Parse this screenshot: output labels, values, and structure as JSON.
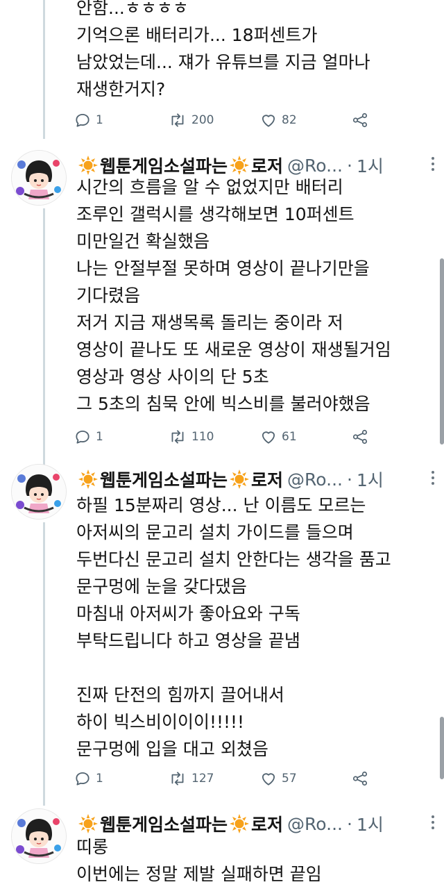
{
  "tweets": [
    {
      "lines": [
        "안함...ㅎㅎㅎㅎ",
        "기억으론 배터리가... 18퍼센트가",
        "남았었는데... 쟤가 유튜브를 지금 얼마나",
        "재생한거지?"
      ],
      "replies": "1",
      "retweets": "200",
      "likes": "82"
    },
    {
      "name": "웹툰게임소설파는",
      "name_suffix": "로저",
      "handle": "@Ro...",
      "time": "1시",
      "lines": [
        "시간의 흐름을 알 수 없었지만 배터리",
        "조루인 갤럭시를 생각해보면 10퍼센트",
        "미만일건 확실했음",
        "나는 안절부절 못하며 영상이 끝나기만을",
        "기다렸음",
        "저거 지금 재생목록 돌리는 중이라 저",
        "영상이 끝나도 또 새로운 영상이 재생될거임",
        "영상과 영상 사이의 단 5초",
        "그 5초의 침묵 안에 빅스비를 불러야했음"
      ],
      "replies": "1",
      "retweets": "110",
      "likes": "61"
    },
    {
      "name": "웹툰게임소설파는",
      "name_suffix": "로저",
      "handle": "@Ro...",
      "time": "1시",
      "lines": [
        "하필 15분짜리 영상... 난 이름도 모르는",
        "아저씨의 문고리 설치 가이드를 들으며",
        "두번다신 문고리 설치 안한다는 생각을 품고",
        "문구멍에 눈을 갖다댔음",
        "마침내 아저씨가 좋아요와 구독",
        "부탁드립니다 하고 영상을 끝냄",
        "",
        "진짜 단전의 힘까지 끌어내서",
        "하이 빅스비이이이!!!!!",
        "문구멍에 입을 대고 외쳤음"
      ],
      "replies": "1",
      "retweets": "127",
      "likes": "57"
    },
    {
      "name": "웹툰게임소설파는",
      "name_suffix": "로저",
      "handle": "@Ro...",
      "time": "1시",
      "lines": [
        "띠롱",
        "이번에는 정말 제발 실패하면 끝임"
      ]
    }
  ],
  "icons": {
    "reply": "reply-icon",
    "retweet": "retweet-icon",
    "like": "heart-icon",
    "share": "share-icon",
    "sun": "sun-emoji-icon",
    "more": "more-options-icon"
  },
  "colors": {
    "text": "#141414",
    "muted": "#536471",
    "thread_line": "#cfd9de",
    "sun": "#f7a21b"
  }
}
